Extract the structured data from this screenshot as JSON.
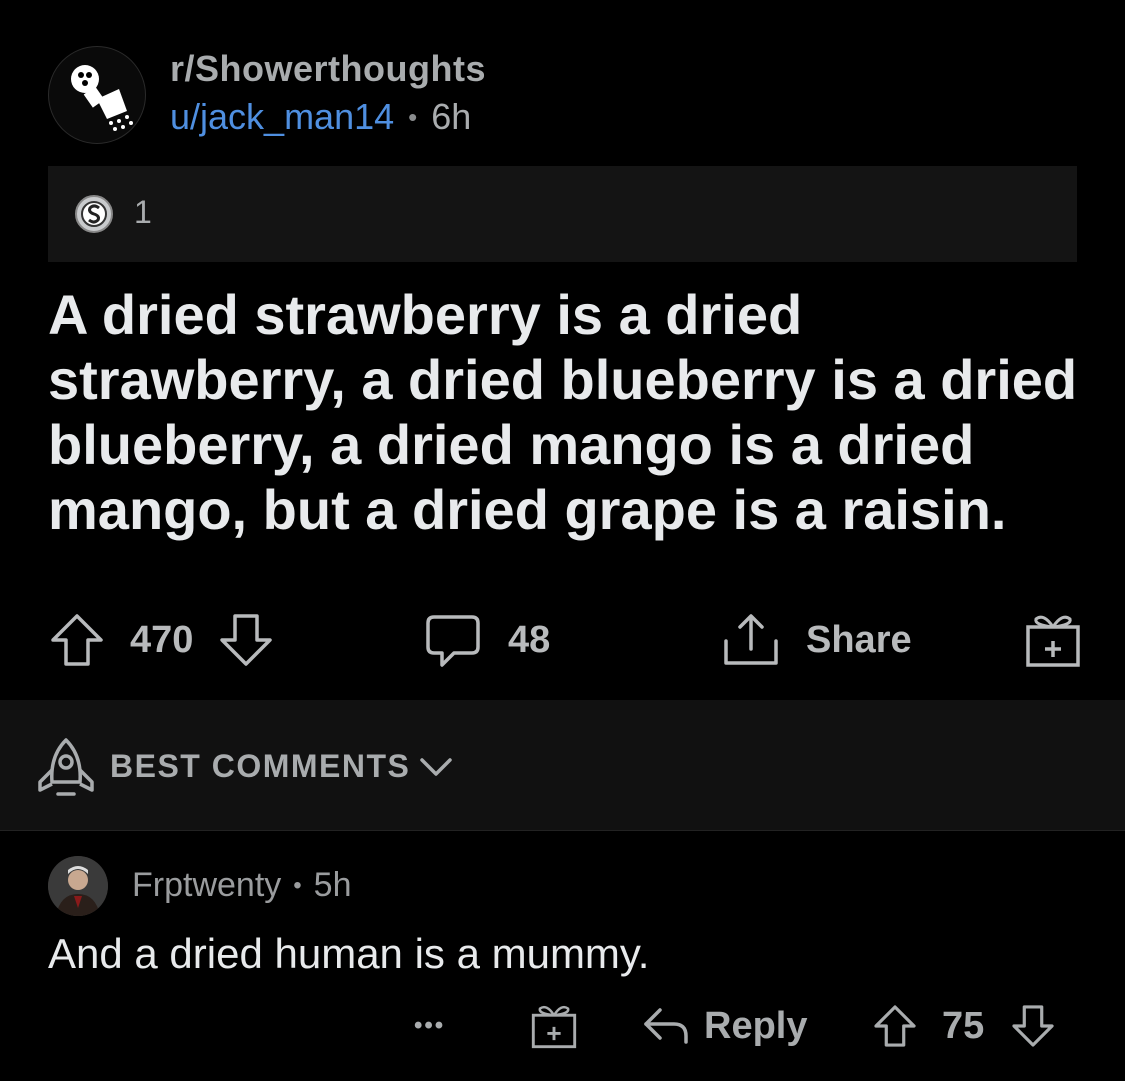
{
  "post": {
    "subreddit": "r/Showerthoughts",
    "author": "u/jack_man14",
    "separator": "•",
    "age": "6h",
    "award_count": "1",
    "title": "A dried strawberry is a dried strawberry, a dried blueberry is a dried blueberry, a dried mango is a dried mango, but a dried grape is a raisin.",
    "upvotes": "470",
    "comments": "48",
    "share_label": "Share"
  },
  "comments_section": {
    "sort_label": "BEST COMMENTS"
  },
  "comment": {
    "author": "Frptwenty",
    "separator": "•",
    "age": "5h",
    "body": "And a dried human is a mummy.",
    "more": "•••",
    "reply_label": "Reply",
    "score": "75"
  },
  "colors": {
    "background": "#000000",
    "username": "#4f8fe0",
    "text": "#e8eaec",
    "muted": "#a9acae"
  },
  "icons": [
    "showerthoughts-logo-icon",
    "silver-award-icon",
    "upvote-icon",
    "downvote-icon",
    "comment-icon",
    "share-icon",
    "gift-award-icon",
    "rocket-icon",
    "chevron-down-icon",
    "reply-icon",
    "more-icon"
  ]
}
